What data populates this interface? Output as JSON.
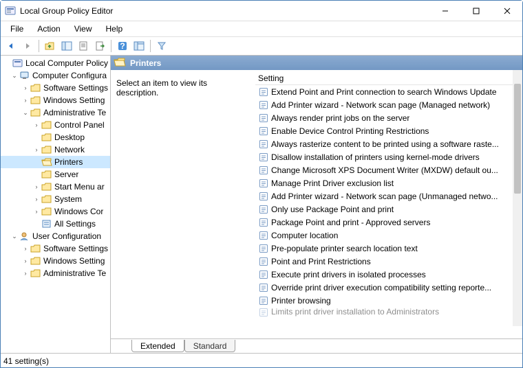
{
  "window": {
    "title": "Local Group Policy Editor"
  },
  "menu": {
    "file": "File",
    "action": "Action",
    "view": "View",
    "help": "Help"
  },
  "header": {
    "label": "Printers"
  },
  "desc": {
    "text": "Select an item to view its description."
  },
  "list": {
    "column_setting": "Setting",
    "items": [
      "Extend Point and Print connection to search Windows Update",
      "Add Printer wizard - Network scan page (Managed network)",
      "Always render print jobs on the server",
      "Enable Device Control Printing Restrictions",
      "Always rasterize content to be printed using a software raste...",
      "Disallow installation of printers using kernel-mode drivers",
      "Change Microsoft XPS Document Writer (MXDW) default ou...",
      "Manage Print Driver exclusion list",
      "Add Printer wizard - Network scan page (Unmanaged netwo...",
      "Only use Package Point and print",
      "Package Point and print - Approved servers",
      "Computer location",
      "Pre-populate printer search location text",
      "Point and Print Restrictions",
      "Execute print drivers in isolated processes",
      "Override print driver execution compatibility setting reporte...",
      "Printer browsing",
      "Limits print driver installation to Administrators"
    ]
  },
  "tabs": {
    "extended": "Extended",
    "standard": "Standard"
  },
  "tree": {
    "root": "Local Computer Policy",
    "comp_cfg": "Computer Configura",
    "soft_set": "Software Settings",
    "win_set": "Windows Setting",
    "admin_t": "Administrative Te",
    "ctrl_panel": "Control Panel",
    "desktop": "Desktop",
    "network": "Network",
    "printers": "Printers",
    "server": "Server",
    "start_menu": "Start Menu ar",
    "system": "System",
    "win_com": "Windows Cor",
    "all_set": "All Settings",
    "user_cfg": "User Configuration",
    "u_soft_set": "Software Settings",
    "u_win_set": "Windows Setting",
    "u_admin_t": "Administrative Te"
  },
  "status": {
    "text": "41 setting(s)"
  }
}
